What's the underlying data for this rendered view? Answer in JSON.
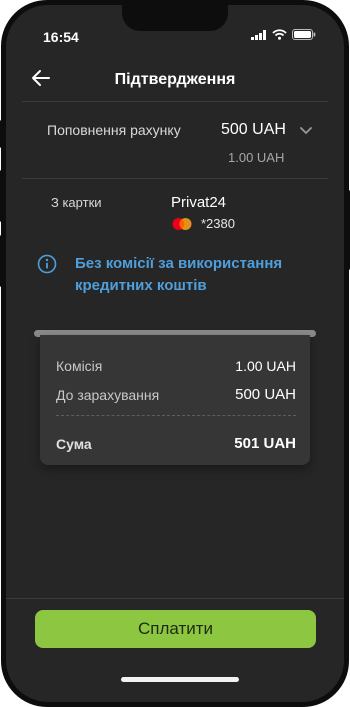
{
  "status_bar": {
    "time": "16:54"
  },
  "header": {
    "title": "Підтвердження"
  },
  "top_up": {
    "label": "Поповнення рахунку",
    "amount": "500 UAH",
    "sub_amount": "1.00 UAH"
  },
  "card": {
    "label": "З картки",
    "name": "Privat24",
    "number": "*2380"
  },
  "info": {
    "line1": "Без комісії за використання",
    "line2": "кредитних коштів"
  },
  "receipt": {
    "commission_label": "Комісія",
    "commission_value": "1.00 UAH",
    "credit_label": "До зарахування",
    "credit_value": "500 UAH",
    "total_label": "Сума",
    "total_value": "501 UAH"
  },
  "footer": {
    "pay_label": "Сплатити"
  },
  "colors": {
    "background": "#262626",
    "accent_green": "#8dc641",
    "info_blue": "#4f9fdc"
  },
  "icons": [
    "back-arrow-icon",
    "chevron-down-icon",
    "mastercard-icon",
    "info-icon",
    "signal-icon",
    "wifi-icon",
    "battery-icon"
  ]
}
